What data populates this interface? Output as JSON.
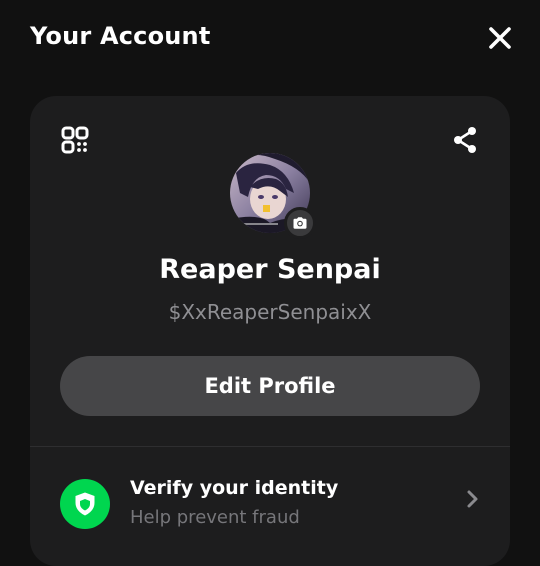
{
  "header": {
    "title": "Your Account",
    "close_icon": "close-icon"
  },
  "profile_card": {
    "qr_icon": "qr-code-icon",
    "share_icon": "share-icon",
    "avatar_description": "profile-photo",
    "camera_icon": "camera-icon",
    "display_name": "Reaper Senpai",
    "cashtag": "$XxReaperSenpaixX",
    "edit_button_label": "Edit Profile"
  },
  "verify": {
    "icon": "shield-icon",
    "title": "Verify your identity",
    "subtitle": "Help prevent fraud",
    "chevron_icon": "chevron-right-icon"
  },
  "colors": {
    "background": "#111111",
    "card": "#1d1d1e",
    "button": "#464648",
    "accent_green": "#00d64f",
    "muted_text": "#8f8f93"
  }
}
